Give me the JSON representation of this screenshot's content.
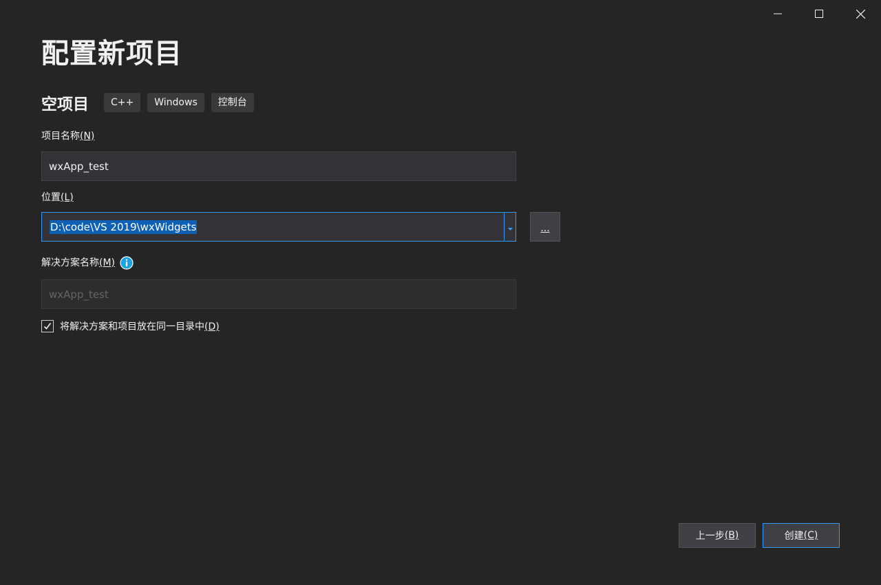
{
  "window": {
    "controls": {
      "minimize_icon": "minimize-icon",
      "maximize_icon": "maximize-icon",
      "close_icon": "close-icon"
    }
  },
  "header": {
    "title": "配置新项目"
  },
  "template": {
    "name": "空项目",
    "tags": [
      "C++",
      "Windows",
      "控制台"
    ]
  },
  "project_name": {
    "label": "项目名称",
    "mnemonic": "(N)",
    "value": "wxApp_test"
  },
  "location": {
    "label": "位置",
    "mnemonic": "(L)",
    "value": "D:\\code\\VS 2019\\wxWidgets",
    "browse_label": "..."
  },
  "solution_name": {
    "label": "解决方案名称",
    "mnemonic": "(M)",
    "value": "wxApp_test",
    "info_icon": "info-icon"
  },
  "same_directory": {
    "label": "将解决方案和项目放在同一目录中",
    "mnemonic": "(D)",
    "checked": true
  },
  "footer": {
    "back_label": "上一步",
    "back_mnemonic": "(B)",
    "create_label": "创建",
    "create_mnemonic": "(C)"
  },
  "colors": {
    "background": "#252526",
    "input_bg": "#333337",
    "accent": "#3399ff",
    "selection": "#0e60b5",
    "info": "#1ba1e2"
  }
}
